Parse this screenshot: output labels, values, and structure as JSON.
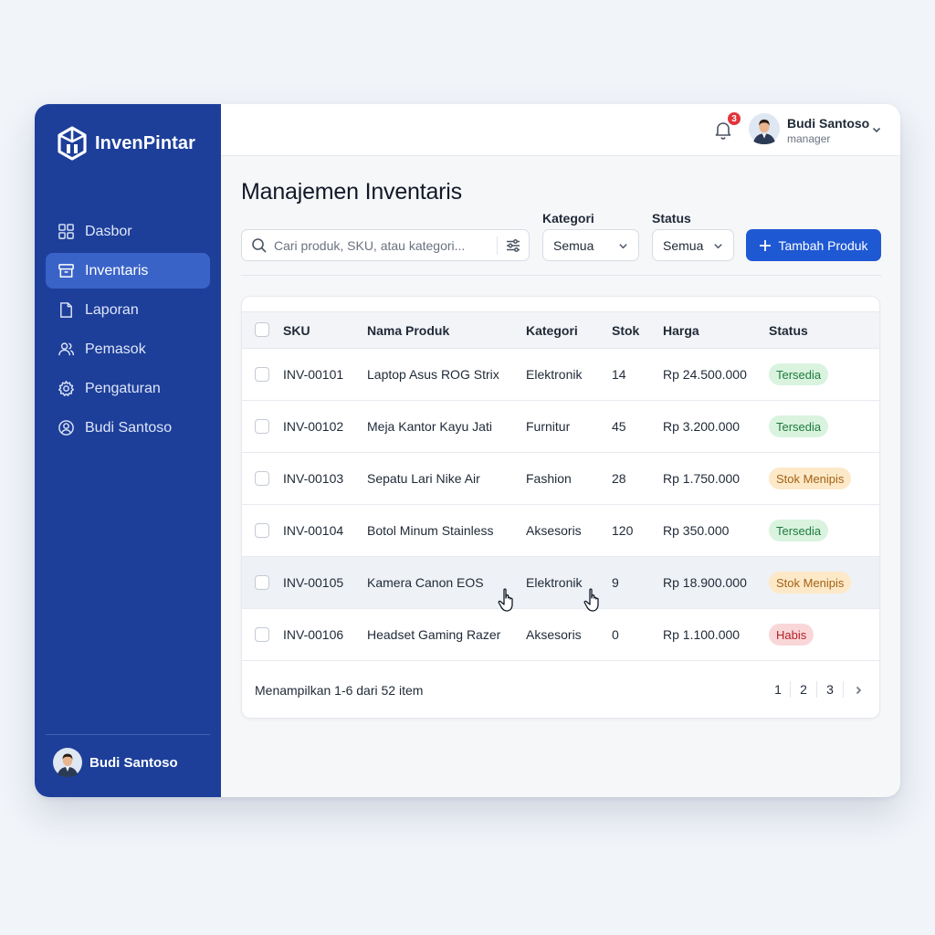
{
  "app": {
    "name": "InvenPintar"
  },
  "sidebar": {
    "items": [
      {
        "label": "Dasbor",
        "icon": "grid-icon",
        "active": false
      },
      {
        "label": "Inventaris",
        "icon": "box-icon",
        "active": true
      },
      {
        "label": "Laporan",
        "icon": "document-icon",
        "active": false
      },
      {
        "label": "Pemasok",
        "icon": "users-icon",
        "active": false
      },
      {
        "label": "Pengaturan",
        "icon": "gear-icon",
        "active": false
      },
      {
        "label": "Budi Santoso",
        "icon": "user-circle-icon",
        "active": false
      }
    ],
    "user": {
      "name": "Budi Santoso"
    }
  },
  "topbar": {
    "notifications": "3",
    "user": {
      "name": "Budi Santoso",
      "role": "manager"
    }
  },
  "page": {
    "title": "Manajemen Inventaris"
  },
  "toolbar": {
    "search_placeholder": "Cari produk, SKU, atau kategori...",
    "kategori": {
      "label": "Kategori",
      "value": "Semua"
    },
    "status": {
      "label": "Status",
      "value": "Semua"
    },
    "add_label": "Tambah Produk"
  },
  "table": {
    "columns": [
      "SKU",
      "Nama Produk",
      "Kategori",
      "Stok",
      "Harga",
      "Status"
    ],
    "rows": [
      {
        "sku": "INV-00101",
        "name": "Laptop Asus ROG Strix",
        "category": "Elektronik",
        "stock": "14",
        "price": "Rp 24.500.000",
        "status": "Tersedia"
      },
      {
        "sku": "INV-00102",
        "name": "Meja Kantor Kayu Jati",
        "category": "Furnitur",
        "stock": "45",
        "price": "Rp 3.200.000",
        "status": "Tersedia"
      },
      {
        "sku": "INV-00103",
        "name": "Sepatu Lari Nike Air",
        "category": "Fashion",
        "stock": "28",
        "price": "Rp 1.750.000",
        "status": "Stok Menipis"
      },
      {
        "sku": "INV-00104",
        "name": "Botol Minum Stainless",
        "category": "Aksesoris",
        "stock": "120",
        "price": "Rp 350.000",
        "status": "Tersedia"
      },
      {
        "sku": "INV-00105",
        "name": "Kamera Canon EOS",
        "category": "Elektronik",
        "stock": "9",
        "price": "Rp 18.900.000",
        "status": "Stok Menipis"
      },
      {
        "sku": "INV-00106",
        "name": "Headset Gaming Razer",
        "category": "Aksesoris",
        "stock": "0",
        "price": "Rp 1.100.000",
        "status": "Habis"
      }
    ],
    "footer": "Menampilkan 1-6 dari 52 item",
    "pages": [
      "1",
      "2",
      "3"
    ]
  },
  "colors": {
    "sidebar": "#1d3f9a",
    "accent": "#1e58d3",
    "ok": "#1f7a3d",
    "low": "#a26214",
    "out": "#b4232c"
  }
}
